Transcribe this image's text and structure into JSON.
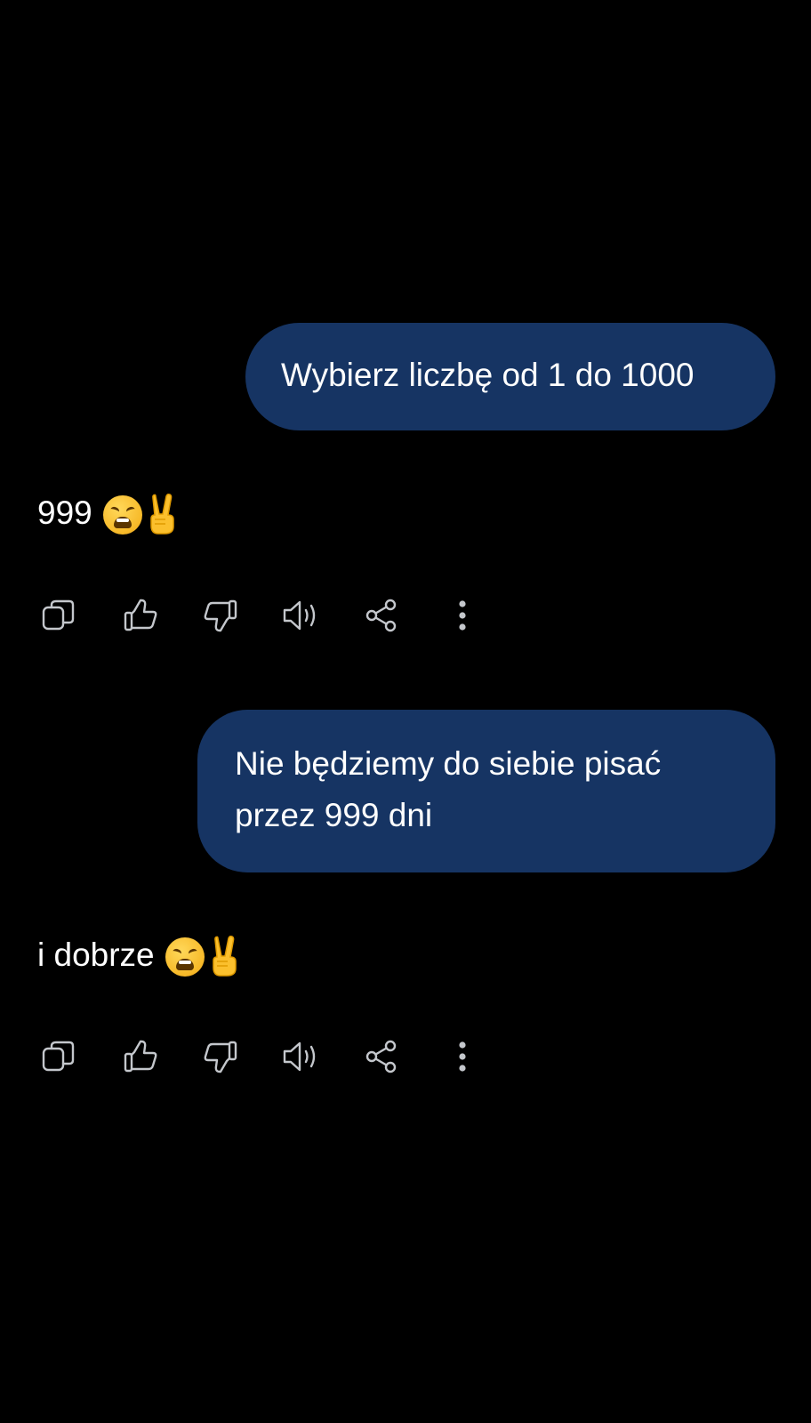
{
  "conversation": {
    "messages": [
      {
        "role": "user",
        "text": "Wybierz liczbę od 1 do 1000"
      },
      {
        "role": "assistant",
        "text": "999",
        "emojis": [
          "weary-face-emoji",
          "victory-hand-emoji"
        ]
      },
      {
        "role": "user",
        "text": "Nie będziemy do siebie pisać przez 999 dni"
      },
      {
        "role": "assistant",
        "text": "i dobrze",
        "emojis": [
          "weary-face-emoji",
          "victory-hand-emoji"
        ]
      }
    ]
  },
  "actions": [
    {
      "icon": "copy-icon"
    },
    {
      "icon": "thumbs-up-icon"
    },
    {
      "icon": "thumbs-down-icon"
    },
    {
      "icon": "speaker-icon"
    },
    {
      "icon": "share-icon"
    },
    {
      "icon": "more-vertical-icon"
    }
  ],
  "colors": {
    "background": "#000000",
    "user_bubble": "#163463",
    "text": "#ffffff",
    "icon": "#c4c7cc"
  }
}
